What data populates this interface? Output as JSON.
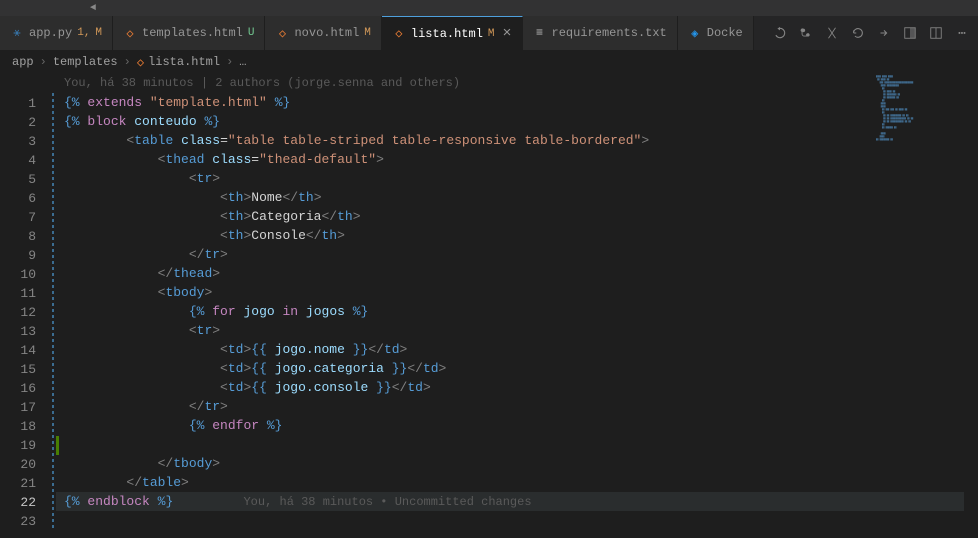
{
  "tabs": [
    {
      "name": "app.py",
      "icon": "py",
      "status_num": "1,",
      "status": "M",
      "active": false
    },
    {
      "name": "templates.html",
      "icon": "html",
      "status": "U",
      "active": false
    },
    {
      "name": "novo.html",
      "icon": "html",
      "status": "M",
      "active": false
    },
    {
      "name": "lista.html",
      "icon": "html",
      "status": "M",
      "active": true
    },
    {
      "name": "requirements.txt",
      "icon": "txt",
      "status": "",
      "active": false
    },
    {
      "name": "Docke",
      "icon": "docker",
      "status": "",
      "active": false
    }
  ],
  "breadcrumbs": {
    "items": [
      "app",
      "templates",
      "lista.html"
    ],
    "trail": "…"
  },
  "blame": {
    "top": "You, há 38 minutos | 2 authors (jorge.senna and others)",
    "inline": "You, há 38 minutos • Uncommitted changes"
  },
  "code": {
    "l1": "{% extends \"template.html\" %}",
    "l2": "{% block conteudo %}",
    "l3_a": "<table",
    "l3_b": "class=",
    "l3_c": "\"table table-striped table-responsive table-bordered\"",
    "l4_a": "<thead",
    "l4_b": "class=",
    "l4_c": "\"thead-default\"",
    "l5": "<tr>",
    "l6_tag": "th",
    "l6_text": "Nome",
    "l7_tag": "th",
    "l7_text": "Categoria",
    "l8_tag": "th",
    "l8_text": "Console",
    "l9": "</tr>",
    "l10": "</thead>",
    "l11": "<tbody>",
    "l12": "{% for jogo in jogos %}",
    "l13": "<tr>",
    "l14_tag": "td",
    "l14_var": "jogo.nome",
    "l15_tag": "td",
    "l15_var": "jogo.categoria",
    "l16_tag": "td",
    "l16_var": "jogo.console",
    "l17": "</tr>",
    "l18": "{% endfor %}",
    "l20": "</tbody>",
    "l21": "</table>",
    "l22": "{% endblock %}"
  },
  "line_count": 23,
  "current_line": 22
}
